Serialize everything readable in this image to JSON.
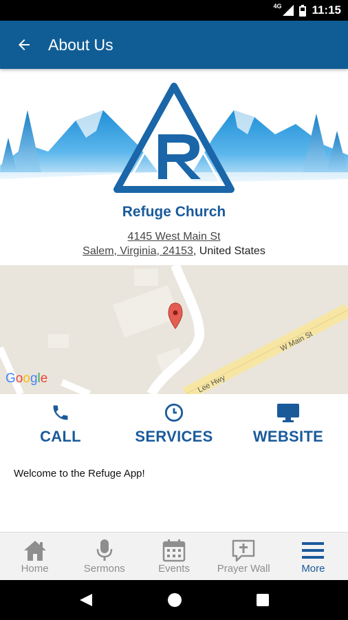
{
  "status_bar": {
    "network": "4G",
    "time": "11:15"
  },
  "app_bar": {
    "title": "About Us",
    "back_icon": "arrow-left-icon"
  },
  "church": {
    "name": "Refuge Church",
    "address_line1": "4145 West Main St",
    "address_line2_link": "Salem, Virginia, 24153",
    "address_country": ", United States"
  },
  "map": {
    "provider_label": "Google",
    "street_labels": [
      "W Main St",
      "Lee Hwy"
    ]
  },
  "actions": [
    {
      "label": "CALL",
      "icon": "phone-icon"
    },
    {
      "label": "SERVICES",
      "icon": "clock-icon"
    },
    {
      "label": "WEBSITE",
      "icon": "monitor-icon"
    }
  ],
  "welcome_text": "Welcome to the Refuge App!",
  "bottom_nav": [
    {
      "label": "Home",
      "icon": "home-icon"
    },
    {
      "label": "Sermons",
      "icon": "microphone-icon"
    },
    {
      "label": "Events",
      "icon": "calendar-icon"
    },
    {
      "label": "Prayer Wall",
      "icon": "prayer-bubble-icon"
    },
    {
      "label": "More",
      "icon": "menu-icon",
      "active": true
    }
  ],
  "colors": {
    "primary": "#105d96",
    "accent": "#1a5a9b",
    "inactive": "#8e8e8e"
  }
}
